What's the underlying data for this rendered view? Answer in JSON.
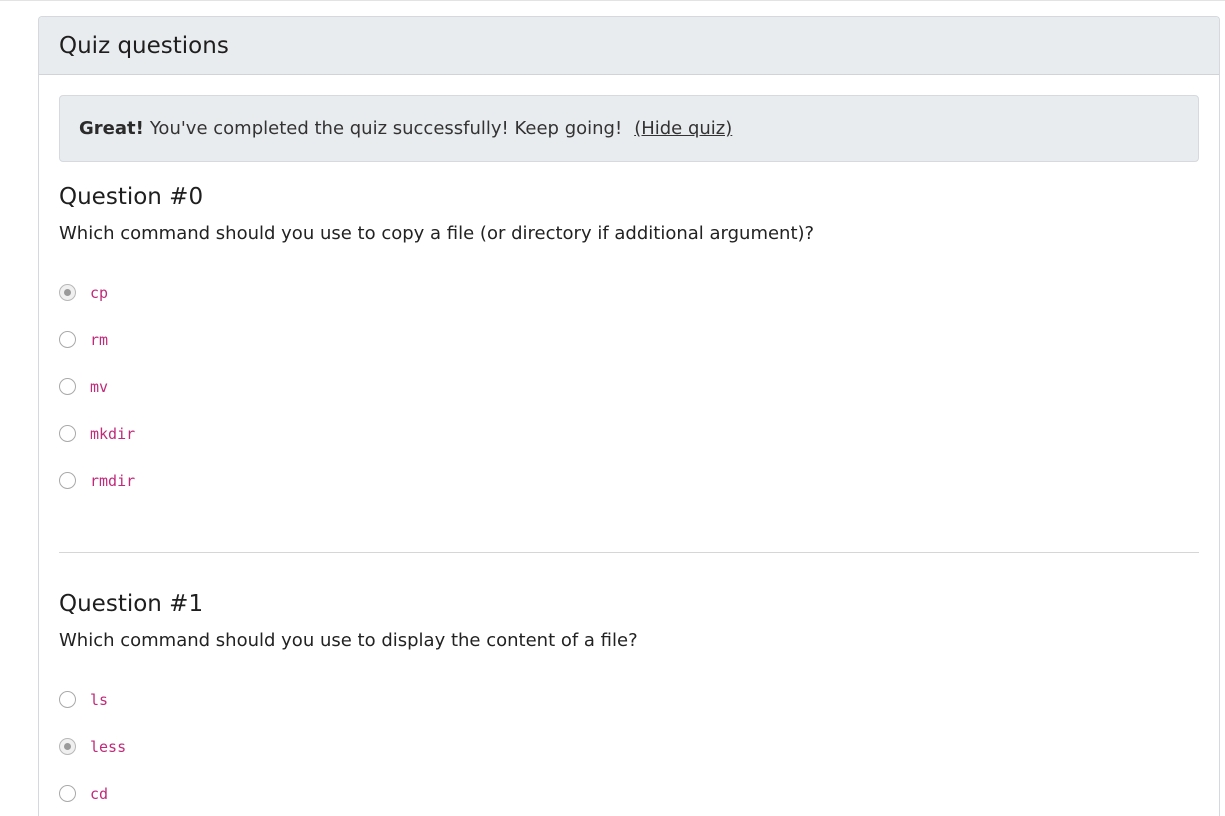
{
  "card": {
    "title": "Quiz questions"
  },
  "alert": {
    "strong": "Great!",
    "message": "You've completed the quiz successfully! Keep going!",
    "hide_link": "(Hide quiz)"
  },
  "questions": [
    {
      "title": "Question #0",
      "text": "Which command should you use to copy a file (or directory if additional argument)?",
      "options": [
        {
          "label": "cp",
          "checked": true
        },
        {
          "label": "rm",
          "checked": false
        },
        {
          "label": "mv",
          "checked": false
        },
        {
          "label": "mkdir",
          "checked": false
        },
        {
          "label": "rmdir",
          "checked": false
        }
      ]
    },
    {
      "title": "Question #1",
      "text": "Which command should you use to display the content of a file?",
      "options": [
        {
          "label": "ls",
          "checked": false
        },
        {
          "label": "less",
          "checked": true
        },
        {
          "label": "cd",
          "checked": false
        }
      ]
    }
  ],
  "colors": {
    "header_bg": "#e9ecef",
    "code_text": "#c02a7a"
  }
}
